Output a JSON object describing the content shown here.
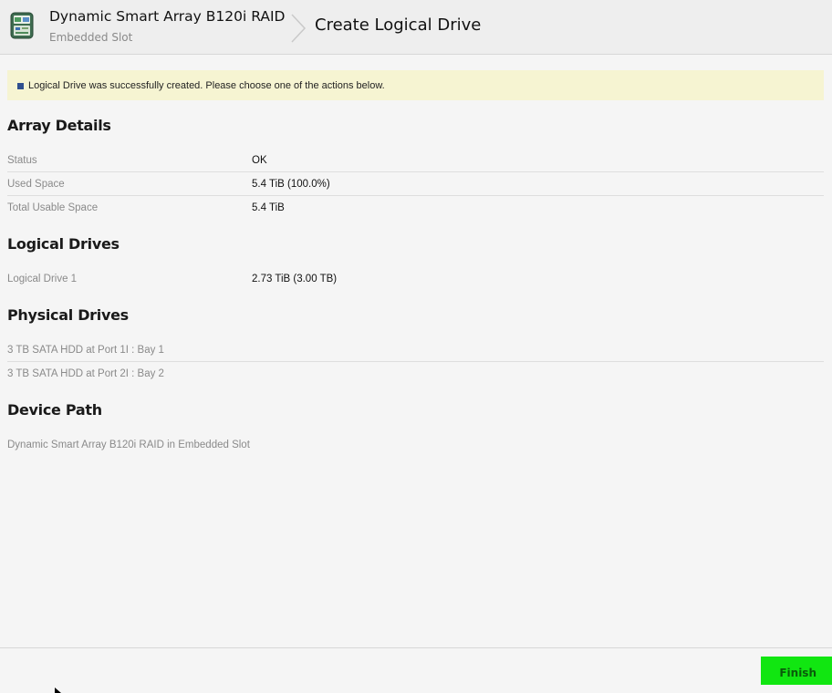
{
  "header": {
    "controller_name": "Dynamic Smart Array B120i RAID",
    "controller_slot": "Embedded Slot",
    "page_title": "Create Logical Drive",
    "icon": "controller-card-icon"
  },
  "notice": {
    "message": "Logical Drive was successfully created. Please choose one of the actions below."
  },
  "array_details": {
    "heading": "Array Details",
    "rows": [
      {
        "label": "Status",
        "value": "OK"
      },
      {
        "label": "Used Space",
        "value": "5.4 TiB (100.0%)"
      },
      {
        "label": "Total Usable Space",
        "value": "5.4 TiB"
      }
    ]
  },
  "logical_drives": {
    "heading": "Logical Drives",
    "rows": [
      {
        "label": "Logical Drive 1",
        "value": "2.73 TiB (3.00 TB)"
      }
    ]
  },
  "physical_drives": {
    "heading": "Physical Drives",
    "rows": [
      {
        "label": "3 TB SATA HDD at Port 1I : Bay 1"
      },
      {
        "label": "3 TB SATA HDD at Port 2I : Bay 2"
      }
    ]
  },
  "device_path": {
    "heading": "Device Path",
    "value": "Dynamic Smart Array B120i RAID in Embedded Slot"
  },
  "footer": {
    "finish_label": "Finish"
  },
  "colors": {
    "finish_button": "#11e611",
    "notice_background": "#f6f4d2",
    "notice_marker": "#2f4f8f"
  }
}
